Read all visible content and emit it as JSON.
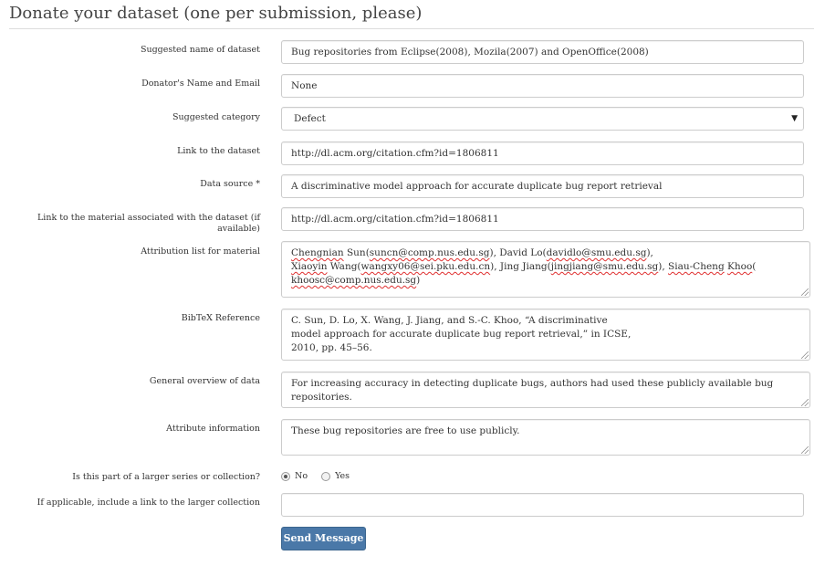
{
  "page": {
    "title": "Donate your dataset (one per submission, please)"
  },
  "form": {
    "name": {
      "label": "Suggested name of dataset",
      "value": "Bug repositories from Eclipse(2008), Mozila(2007) and OpenOffice(2008)"
    },
    "donator": {
      "label": "Donator's Name and Email",
      "value": "None"
    },
    "category": {
      "label": "Suggested category",
      "value": "Defect"
    },
    "link": {
      "label": "Link to the dataset",
      "value": "http://dl.acm.org/citation.cfm?id=1806811"
    },
    "source": {
      "label": "Data source *",
      "value": "A discriminative model approach for accurate duplicate bug report retrieval"
    },
    "material_link": {
      "label": "Link to the material associated with the dataset (if available)",
      "value": "http://dl.acm.org/citation.cfm?id=1806811"
    },
    "attribution": {
      "label": "Attribution list for material",
      "p1": "Chengnian Sun(",
      "e1": "suncn@comp.nus.edu.sg",
      "p2": "), David Lo(",
      "e2": "davidlo@smu.edu.sg",
      "p3": "),",
      "p4": "Xiaoyin Wang(",
      "e3": "wangxy06@sei.pku.edu.cn",
      "p5": "), Jing Jiang(",
      "e4": "jingjiang@smu.edu.sg",
      "p6": "), Siau-Cheng Khoo(",
      "e5": "khoosc@comp.nus.edu.sg",
      "p7": ")"
    },
    "bibtex": {
      "label": "BibTeX Reference",
      "line1": "C. Sun, D. Lo, X. Wang, J. Jiang, and S.-C. Khoo, “A discriminative",
      "line2": "model approach for accurate duplicate bug report retrieval,” in ICSE,",
      "line3": "2010, pp. 45–56."
    },
    "overview": {
      "label": "General overview of data",
      "value": "For increasing accuracy in detecting duplicate bugs, authors had used these publicly available bug repositories."
    },
    "attributes": {
      "label": "Attribute information",
      "value": "These bug repositories are free  to use publicly."
    },
    "series": {
      "label": "Is this part of a larger series or collection?",
      "options": [
        "No",
        "Yes"
      ],
      "selected": "No"
    },
    "collection_link": {
      "label": "If applicable, include a link to the larger collection",
      "value": ""
    },
    "submit_label": "Send Message"
  }
}
